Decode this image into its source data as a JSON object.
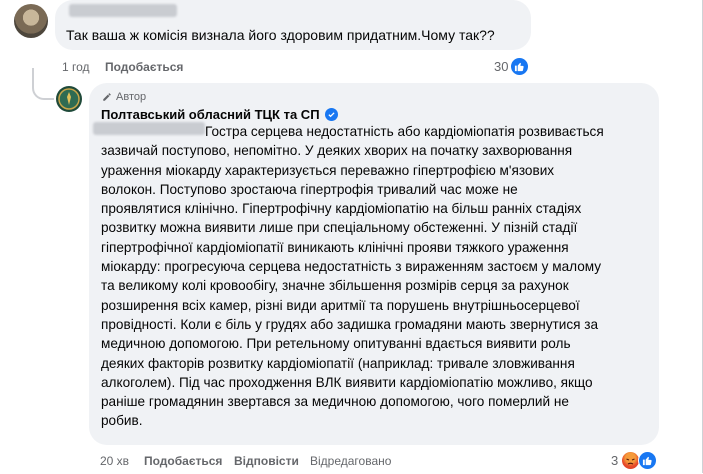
{
  "top_comment": {
    "text": "Так ваша ж комісія визнала його здоровим придатним.Чому так??",
    "time": "1 год",
    "like_label": "Подобається",
    "reaction_count": "30"
  },
  "reply": {
    "author_badge": "Автор",
    "page_name": "Полтавський обласний ТЦК та СП",
    "lines": [
      "Гостра серцева недостатність або кардіоміопатія розвивається",
      "зазвичай поступово, непомітно. У деяких хворих на початку захворювання",
      "ураження міокарду характеризується переважно гіпертрофією м'язових",
      "волокон. Поступово зростаюча гіпертрофія тривалий час може не",
      "проявлятися клінічно. Гіпертрофічну кардіоміопатію на більш ранніх стадіях",
      "розвитку можна виявити лише при спеціальному обстеженні. У пізній стадії",
      "гіпертрофічної кардіоміопатії виникають клінічні прояви тяжкого ураження",
      "міокарду: прогресуюча серцева недостатність з вираженням застоєм у малому",
      "та великому колі кровообігу, значне збільшення розмірів серця за рахунок",
      "розширення всіх камер, різні види аритмії та порушень внутрішньосерцевої",
      "провідності. Коли є біль у грудях або задишка громадяни мають звернутися за",
      "медичною допомогою. При ретельному опитуванні вдається виявити роль",
      "деяких факторів розвитку кардіоміопатії (наприклад: тривале зловживання",
      "алкоголем). Під час проходження ВЛК виявити кардіоміопатію можливо, якщо",
      "раніше громадянин звертався за медичною допомогою, чого померлий не",
      "робив."
    ],
    "time": "20 хв",
    "like_label": "Подобається",
    "reply_label": "Відповісти",
    "edited_label": "Відредаговано",
    "reaction_count": "3"
  },
  "colors": {
    "bubble": "#f0f2f5",
    "meta_text": "#65676b",
    "like_blue": "#1877f2",
    "angry_orange": "#e84b2a"
  },
  "icons": {
    "like": "thumbs-up-icon",
    "angry": "angry-face-icon",
    "verified": "verified-check-icon",
    "author_pen": "pen-icon"
  }
}
